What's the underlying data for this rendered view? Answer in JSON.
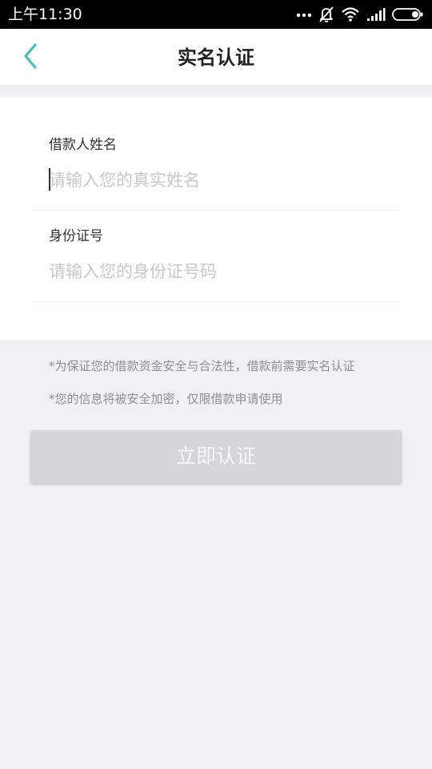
{
  "status_bar": {
    "time": "上午11:30",
    "icons": [
      "more-dots-icon",
      "notifications-off-icon",
      "wifi-icon",
      "signal-icon",
      "battery-icon"
    ]
  },
  "nav": {
    "back_icon": "chevron-left-icon",
    "title": "实名认证"
  },
  "form": {
    "name_field": {
      "label": "借款人姓名",
      "placeholder": "请输入您的真实姓名",
      "value": ""
    },
    "id_field": {
      "label": "身份证号",
      "placeholder": "请输入您的身份证号码",
      "value": ""
    }
  },
  "notices": [
    "*为保证您的借款资金安全与合法性，借款前需要实名认证",
    "*您的信息将被安全加密，仅限借款申请使用"
  ],
  "submit": {
    "label": "立即认证",
    "enabled": false
  },
  "colors": {
    "accent": "#3fc3c0",
    "background": "#efeff4",
    "button_disabled": "#d6d6d9",
    "placeholder": "#c7c7cc"
  }
}
